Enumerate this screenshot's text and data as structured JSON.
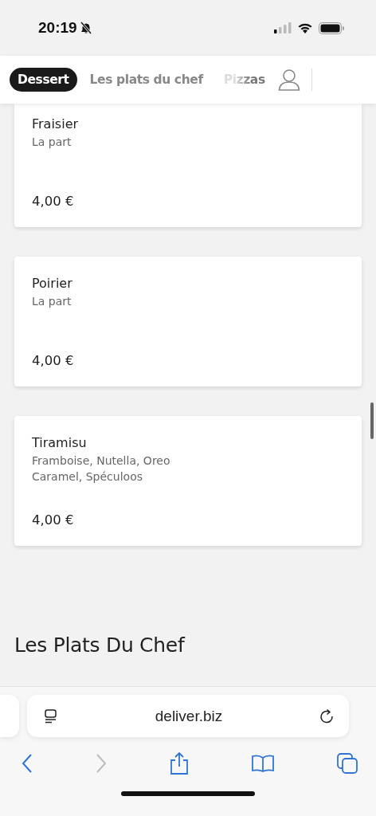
{
  "status_bar": {
    "time": "20:19",
    "muted": true
  },
  "tabs": [
    {
      "label": "Dessert",
      "selected": true
    },
    {
      "label": "Les plats du chef",
      "selected": false
    },
    {
      "label": "Pizzas",
      "selected": false
    }
  ],
  "products": [
    {
      "name": "Fraisier",
      "description": "La part",
      "price": "4,00 €"
    },
    {
      "name": "Poirier",
      "description": "La part",
      "price": "4,00 €"
    },
    {
      "name": "Tiramisu",
      "description": "Framboise, Nutella, Oreo\nCaramel, Spéculoos",
      "price": "4,00 €"
    }
  ],
  "section_heading": "Les Plats Du Chef",
  "browser": {
    "url": "deliver.biz",
    "back_disabled": false,
    "forward_disabled": true
  }
}
